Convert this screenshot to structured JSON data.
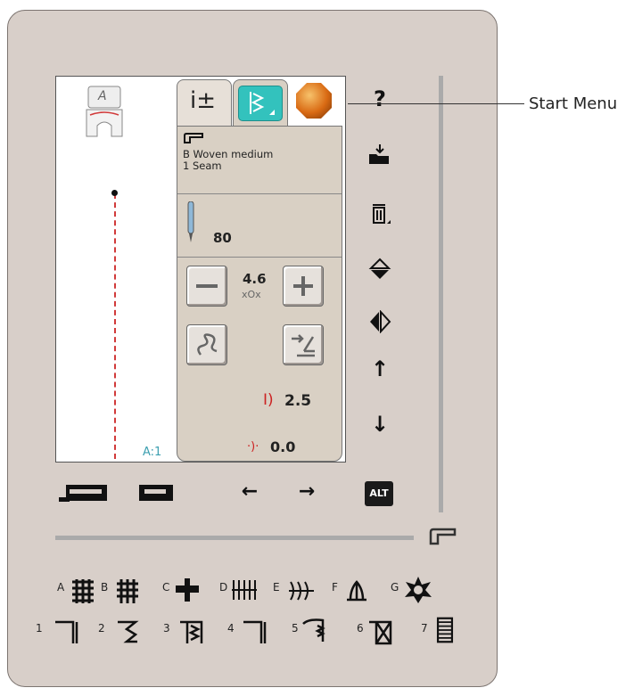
{
  "callout": {
    "start_menu": "Start Menu"
  },
  "foot": {
    "label": "A"
  },
  "stitch": {
    "position_label": "A:1"
  },
  "tabs": {
    "info_glyph": "i±"
  },
  "fabric": {
    "type": "B Woven medium",
    "technique": "1 Seam"
  },
  "needle": {
    "size": "80"
  },
  "stitch_width": {
    "value": "4.6",
    "icon": "xOx"
  },
  "stitch_length": {
    "value": "2.5"
  },
  "stitch_position": {
    "value": "0.0"
  },
  "toolbar": {
    "help": "?",
    "load": "load-icon",
    "delete": "trash-icon",
    "mirror_horizontal": "mirror-horizontal-icon",
    "mirror_vertical": "mirror-vertical-icon",
    "up": "↑",
    "down": "↓"
  },
  "bottom": {
    "left_arrow": "←",
    "right_arrow": "→",
    "alt": "ALT"
  },
  "categories": {
    "row1": [
      "A",
      "B",
      "C",
      "D",
      "E",
      "F",
      "G"
    ],
    "row2": [
      "1",
      "2",
      "3",
      "4",
      "5",
      "6",
      "7"
    ]
  },
  "colors": {
    "accent_teal": "#33c2bd",
    "start_orange": "#d96a13",
    "seam_red": "#d13a3a"
  }
}
